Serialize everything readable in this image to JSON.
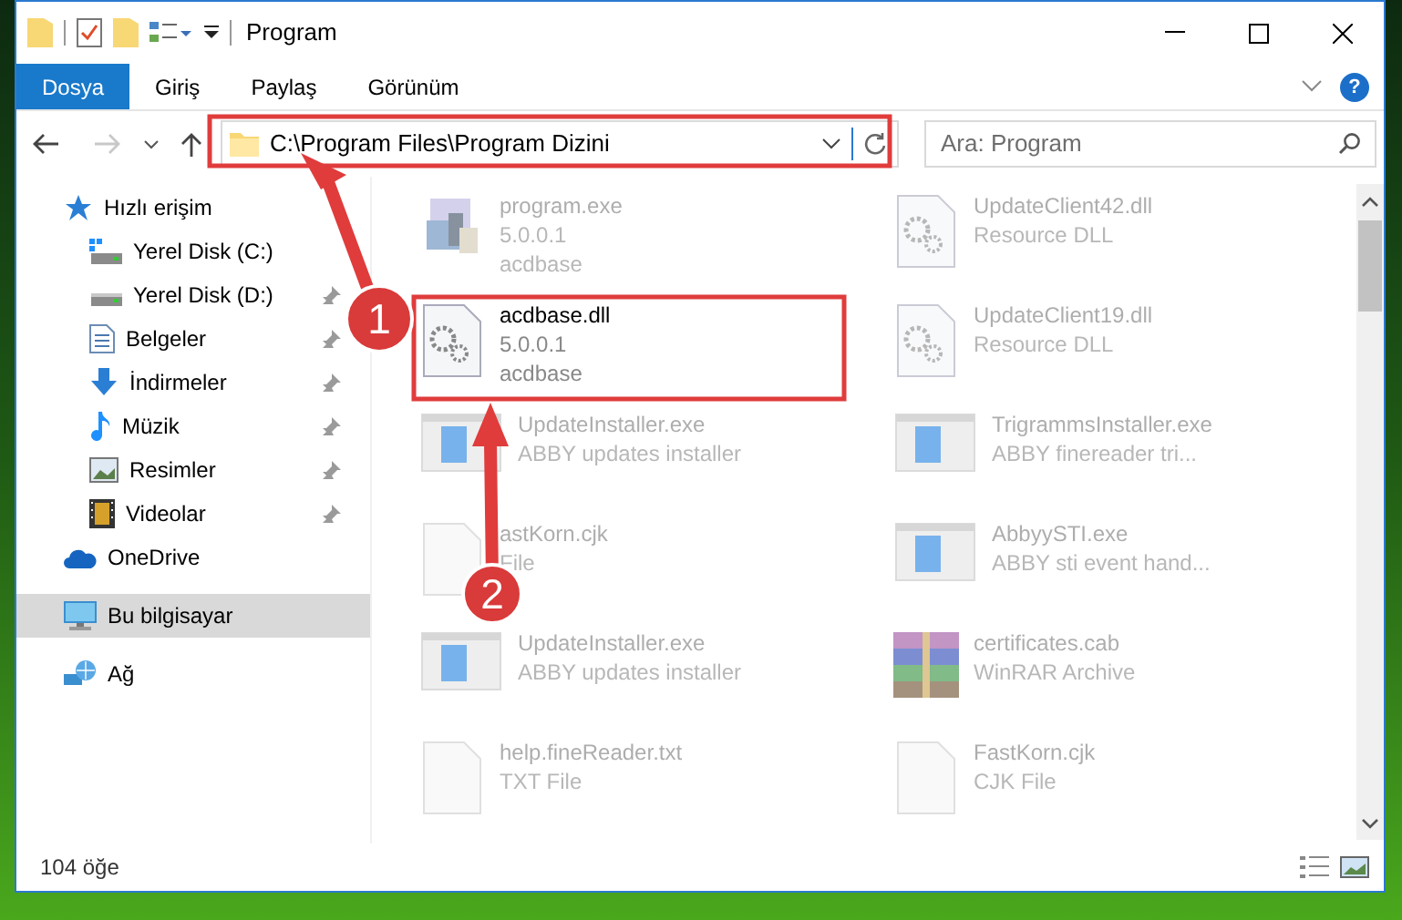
{
  "window": {
    "title": "Program"
  },
  "ribbon_tabs": [
    {
      "label": "Dosya",
      "selected": true
    },
    {
      "label": "Giriş",
      "selected": false
    },
    {
      "label": "Paylaş",
      "selected": false
    },
    {
      "label": "Görünüm",
      "selected": false
    }
  ],
  "help_button": "?",
  "nav": {
    "forward_disabled": true
  },
  "address": {
    "value": "C:\\Program Files\\Program Dizini"
  },
  "search": {
    "placeholder": "Ara: Program"
  },
  "sidebar": {
    "items": [
      {
        "label": "Hızlı erişim",
        "kind": "quick",
        "selected": false,
        "children": [
          {
            "label": "Yerel Disk (C:)",
            "kind": "drive-c",
            "pinned": false,
            "selected": false
          },
          {
            "label": "Yerel Disk (D:)",
            "kind": "drive",
            "pinned": true,
            "selected": false
          },
          {
            "label": "Belgeler",
            "kind": "documents",
            "pinned": true,
            "selected": false
          },
          {
            "label": "İndirmeler",
            "kind": "downloads",
            "pinned": true,
            "selected": false
          },
          {
            "label": "Müzik",
            "kind": "music",
            "pinned": true,
            "selected": false
          },
          {
            "label": "Resimler",
            "kind": "pictures",
            "pinned": true,
            "selected": false
          },
          {
            "label": "Videolar",
            "kind": "videos",
            "pinned": true,
            "selected": false
          }
        ]
      },
      {
        "label": "OneDrive",
        "kind": "cloud",
        "selected": false
      },
      {
        "label": "Bu bilgisayar",
        "kind": "computer",
        "selected": true
      },
      {
        "label": "Ağ",
        "kind": "network",
        "selected": false
      }
    ]
  },
  "files": [
    {
      "name": "program.exe",
      "details": [
        "5.0.0.1",
        "acdbase"
      ],
      "kind": "setup",
      "blurred": true
    },
    {
      "name": "UpdateClient42.dll",
      "details": [
        "Resource DLL"
      ],
      "kind": "dll",
      "blurred": true
    },
    {
      "name": "acdbase.dll",
      "details": [
        "5.0.0.1",
        "acdbase"
      ],
      "kind": "dll",
      "blurred": false
    },
    {
      "name": "UpdateClient19.dll",
      "details": [
        "Resource DLL"
      ],
      "kind": "dll",
      "blurred": true
    },
    {
      "name": "UpdateInstaller.exe",
      "details": [
        "ABBY updates installer"
      ],
      "kind": "app",
      "blurred": true
    },
    {
      "name": "TrigrammsInstaller.exe",
      "details": [
        "ABBY finereader tri..."
      ],
      "kind": "app",
      "blurred": true
    },
    {
      "name": "astKorn.cjk",
      "details": [
        "File"
      ],
      "kind": "blank",
      "blurred": true
    },
    {
      "name": "AbbyySTI.exe",
      "details": [
        "ABBY sti event hand..."
      ],
      "kind": "app",
      "blurred": true
    },
    {
      "name": "UpdateInstaller.exe",
      "details": [
        "ABBY updates installer"
      ],
      "kind": "app",
      "blurred": true
    },
    {
      "name": "certificates.cab",
      "details": [
        "WinRAR Archive"
      ],
      "kind": "archive",
      "blurred": true
    },
    {
      "name": "help.fineReader.txt",
      "details": [
        "TXT File"
      ],
      "kind": "blank",
      "blurred": true
    },
    {
      "name": "FastKorn.cjk",
      "details": [
        "CJK File"
      ],
      "kind": "blank",
      "blurred": true
    }
  ],
  "status_bar": {
    "count": "104 öğe"
  },
  "annotations": [
    {
      "label": "1"
    },
    {
      "label": "2"
    }
  ]
}
